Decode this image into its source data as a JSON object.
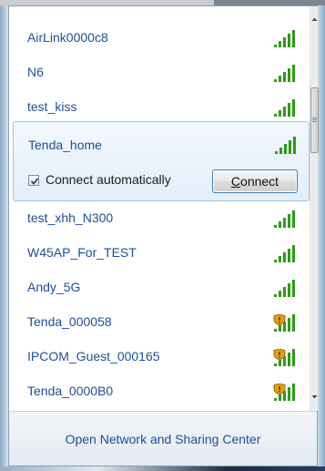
{
  "networks": [
    {
      "ssid": "AirLink0000c8",
      "secured": false
    },
    {
      "ssid": "N6",
      "secured": false
    },
    {
      "ssid": "test_kiss",
      "secured": false
    },
    {
      "ssid": "Tenda_home",
      "secured": false
    },
    {
      "ssid": "test_xhh_N300",
      "secured": false
    },
    {
      "ssid": "W45AP_For_TEST",
      "secured": false
    },
    {
      "ssid": "Andy_5G",
      "secured": false
    },
    {
      "ssid": "Tenda_000058",
      "secured": true
    },
    {
      "ssid": "IPCOM_Guest_000165",
      "secured": true
    },
    {
      "ssid": "Tenda_0000B0",
      "secured": true
    }
  ],
  "selected": {
    "ssid": "Tenda_home",
    "auto_label": "Connect automatically",
    "auto_checked": true,
    "connect_accel": "C",
    "connect_rest": "onnect"
  },
  "footer": {
    "link": "Open Network and Sharing Center"
  },
  "colors": {
    "link": "#1e4d98",
    "signal": "#2f9a1a",
    "shield": "#e0a010"
  }
}
